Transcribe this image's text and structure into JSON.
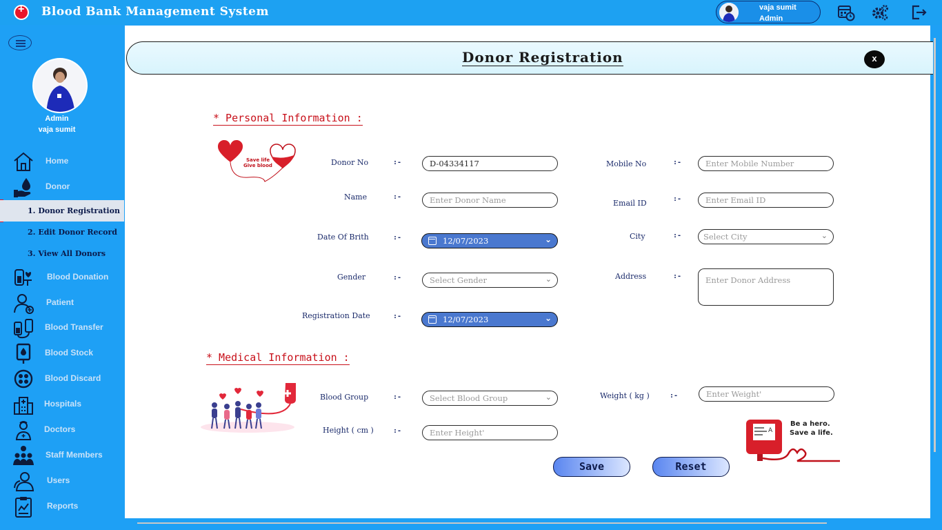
{
  "app": {
    "title": "Blood Bank Management System",
    "user_name": "vaja sumit",
    "user_role": "Admin"
  },
  "topbar_icons": [
    "calendar-clock-icon",
    "settings-gears-icon",
    "logout-icon"
  ],
  "sidebar": {
    "profile_role": "Admin",
    "profile_name": "vaja sumit",
    "items": [
      {
        "label": "Home",
        "icon": "home-icon"
      },
      {
        "label": "Donor",
        "icon": "donor-drop-hand-icon",
        "active": true
      },
      {
        "label": "Blood Donation",
        "icon": "blood-donation-icon"
      },
      {
        "label": "Patient",
        "icon": "patient-icon"
      },
      {
        "label": "Blood Transfer",
        "icon": "blood-transfer-icon"
      },
      {
        "label": "Blood Stock",
        "icon": "blood-stock-icon"
      },
      {
        "label": "Blood Discard",
        "icon": "blood-discard-icon"
      },
      {
        "label": "Hospitals",
        "icon": "hospital-icon"
      },
      {
        "label": "Doctors",
        "icon": "doctor-icon"
      },
      {
        "label": "Staff Members",
        "icon": "staff-members-icon"
      },
      {
        "label": "Users",
        "icon": "users-icon"
      },
      {
        "label": "Reports",
        "icon": "reports-icon"
      }
    ],
    "donor_submenu": [
      {
        "label": "1.  Donor Registration",
        "active": true
      },
      {
        "label": "2.  Edit Donor Record"
      },
      {
        "label": "3.  View All Donors"
      }
    ]
  },
  "form": {
    "title": "Donor Registration",
    "close_label": "x",
    "separator": ":-",
    "personal_section": "*  Personal Information  :",
    "medical_section": "*  Medical Information  :",
    "personal_image_text": [
      "Save life",
      "Give blood"
    ],
    "hero_image_text": [
      "Be a hero.",
      "Save a life."
    ],
    "fields": {
      "donor_no": {
        "label": "Donor No",
        "value": "D-04334117"
      },
      "name": {
        "label": "Name",
        "placeholder": "Enter Donor Name"
      },
      "dob": {
        "label": "Date Of Brith",
        "value": "12/07/2023"
      },
      "gender": {
        "label": "Gender",
        "placeholder": "Select Gender"
      },
      "registration_date": {
        "label": "Registration Date",
        "value": "12/07/2023"
      },
      "mobile_no": {
        "label": "Mobile No",
        "placeholder": "Enter Mobile Number"
      },
      "email": {
        "label": "Email ID",
        "placeholder": "Enter Email ID"
      },
      "city": {
        "label": "City",
        "placeholder": "Select City"
      },
      "address": {
        "label": "Address",
        "placeholder": "Enter Donor Address"
      },
      "blood_group": {
        "label": "Blood Group",
        "placeholder": "Select Blood Group"
      },
      "height": {
        "label": "Height ( cm )",
        "placeholder": "Enter Height'"
      },
      "weight": {
        "label": "Weight ( kg )",
        "placeholder": "Enter Weight'"
      }
    },
    "save_label": "Save",
    "reset_label": "Reset"
  },
  "colors": {
    "primary_blue": "#1ea0f5",
    "accent_red": "#c8101a",
    "date_blue": "#4a78cf",
    "navy_text": "#1a2a6a"
  }
}
